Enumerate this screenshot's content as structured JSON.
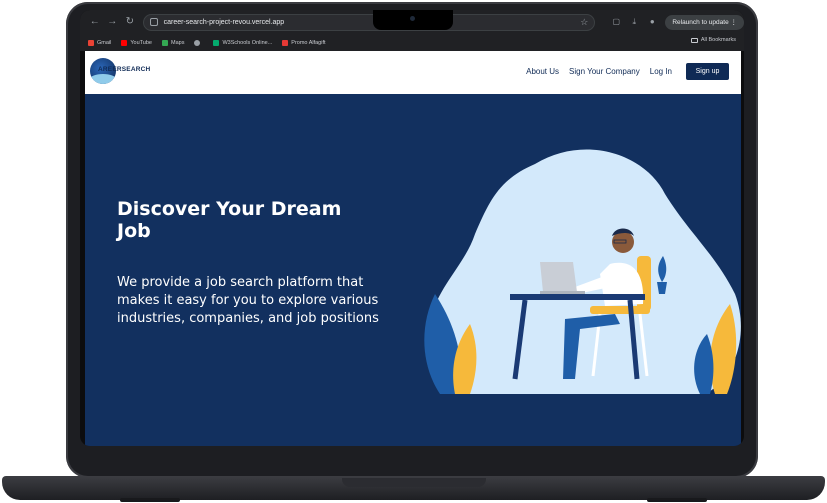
{
  "browser": {
    "url": "career-search-project-revou.vercel.app",
    "relaunch_label": "Relaunch to update",
    "bookmarks": [
      {
        "label": "Gmail",
        "color": "#ea4335"
      },
      {
        "label": "YouTube",
        "color": "#ff0000"
      },
      {
        "label": "Maps",
        "color": "#34a853"
      },
      {
        "label": "",
        "color": "#9aa0a6"
      },
      {
        "label": "W3Schools Online...",
        "color": "#04aa6d"
      },
      {
        "label": "Promo Alfagift",
        "color": "#e53935"
      }
    ],
    "all_bookmarks_label": "All Bookmarks"
  },
  "site": {
    "logo_text": "AREERSEARCH",
    "nav": {
      "about": "About Us",
      "sign_company": "Sign Your Company",
      "login": "Log In",
      "signup": "Sign up"
    },
    "hero": {
      "title": "Discover Your Dream Job",
      "subtitle": "We provide a job search platform that makes it easy for you to explore various industries, companies, and job positions"
    }
  },
  "colors": {
    "primary": "#0f2a55",
    "hero_bg": "#12305f",
    "blob": "#d3e9fb",
    "accent_yellow": "#f6b93b",
    "accent_blue": "#1f5ea8"
  }
}
